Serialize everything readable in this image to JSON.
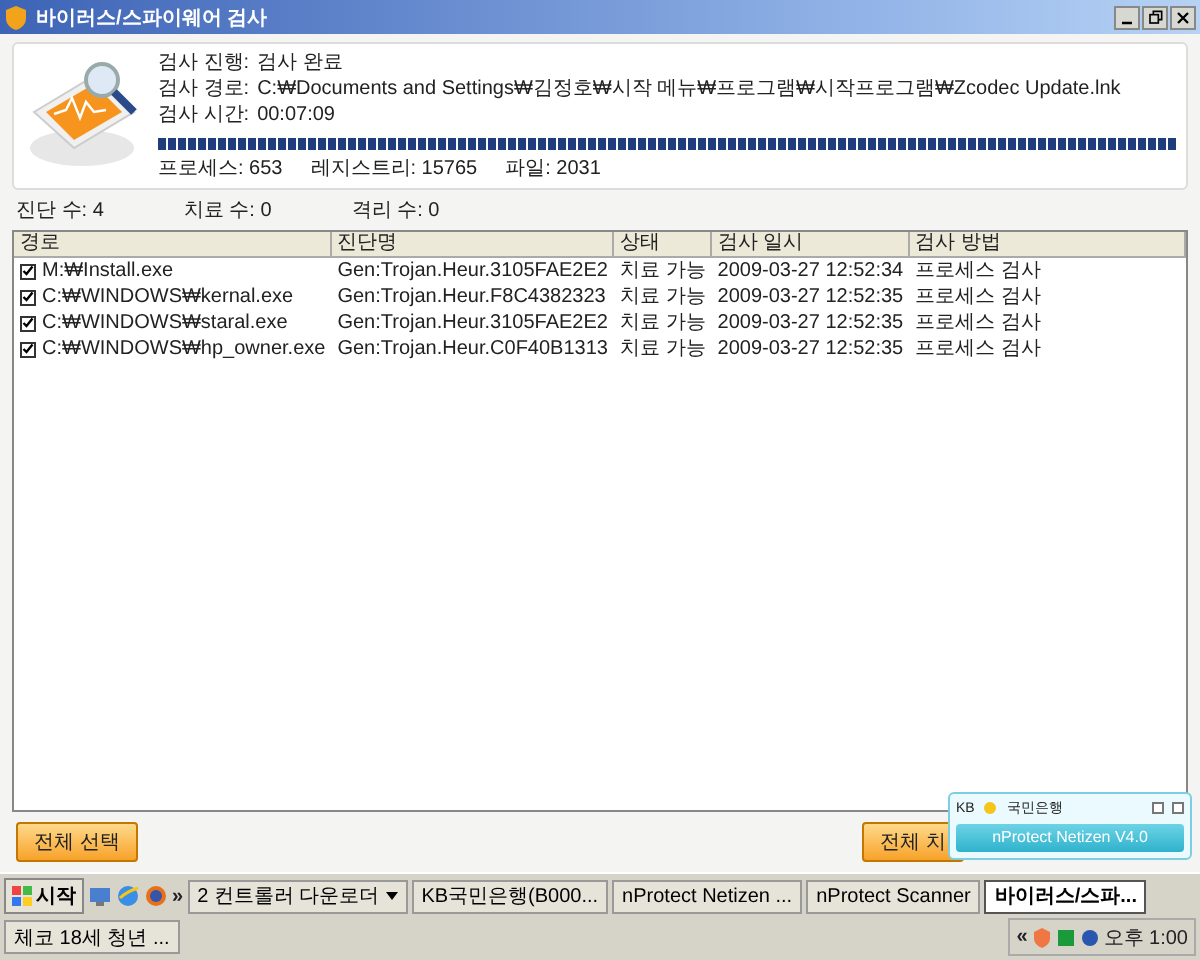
{
  "window": {
    "title": "바이러스/스파이웨어 검사"
  },
  "scan": {
    "fields": [
      {
        "label": "검사 진행:",
        "value": "검사 완료"
      },
      {
        "label": "검사 경로:",
        "value": "C:₩Documents and Settings₩김정호₩시작 메뉴₩프로그램₩시작프로그램₩Zcodec Update.lnk"
      },
      {
        "label": "검사 시간:",
        "value": "00:07:09"
      }
    ],
    "progress": {
      "level": 1
    },
    "stats": [
      "프로세스: 653",
      "레지스트리: 15765",
      "파일: 2031"
    ]
  },
  "counts": [
    "진단 수: 4",
    "치료 수: 0",
    "격리 수: 0"
  ],
  "table": {
    "columns": [
      "경로",
      "진단명",
      "상태",
      "검사 일시",
      "검사 방법"
    ],
    "rows": [
      {
        "checked": true,
        "cells": [
          "M:₩Install.exe",
          "Gen:Trojan.Heur.3105FAE2E2",
          "치료 가능",
          "2009-03-27 12:52:34",
          "프로세스 검사"
        ]
      },
      {
        "checked": true,
        "cells": [
          "C:₩WINDOWS₩kernal.exe",
          "Gen:Trojan.Heur.F8C4382323",
          "치료 가능",
          "2009-03-27 12:52:35",
          "프로세스 검사"
        ]
      },
      {
        "checked": true,
        "cells": [
          "C:₩WINDOWS₩staral.exe",
          "Gen:Trojan.Heur.3105FAE2E2",
          "치료 가능",
          "2009-03-27 12:52:35",
          "프로세스 검사"
        ]
      },
      {
        "checked": true,
        "cells": [
          "C:₩WINDOWS₩hp_owner.exe",
          "Gen:Trojan.Heur.C0F40B1313",
          "치료 가능",
          "2009-03-27 12:52:35",
          "프로세스 검사"
        ]
      }
    ]
  },
  "buttons": [
    "전체 선택",
    "전체 치"
  ],
  "popup": {
    "brand": "KB",
    "bank": "국민은행",
    "options": [
      {
        "checked": false
      },
      {
        "checked": false
      }
    ],
    "title": "nProtect Netizen V4.0"
  },
  "taskbar": {
    "start": "시작",
    "more": "»",
    "items": [
      {
        "label": "2 컨트롤러 다운로더",
        "selected": false,
        "menu": true
      },
      {
        "label": "KB국민은행(B000...",
        "selected": false,
        "menu": false
      },
      {
        "label": "nProtect Netizen ...",
        "selected": false,
        "menu": false
      },
      {
        "label": "nProtect Scanner",
        "selected": false,
        "menu": false
      },
      {
        "label": "바이러스/스파...",
        "selected": true,
        "menu": false
      },
      {
        "label": "체코 18세 청년 ...",
        "selected": false,
        "menu": false
      }
    ],
    "tray_more": "«",
    "clock": "오후 1:00"
  }
}
